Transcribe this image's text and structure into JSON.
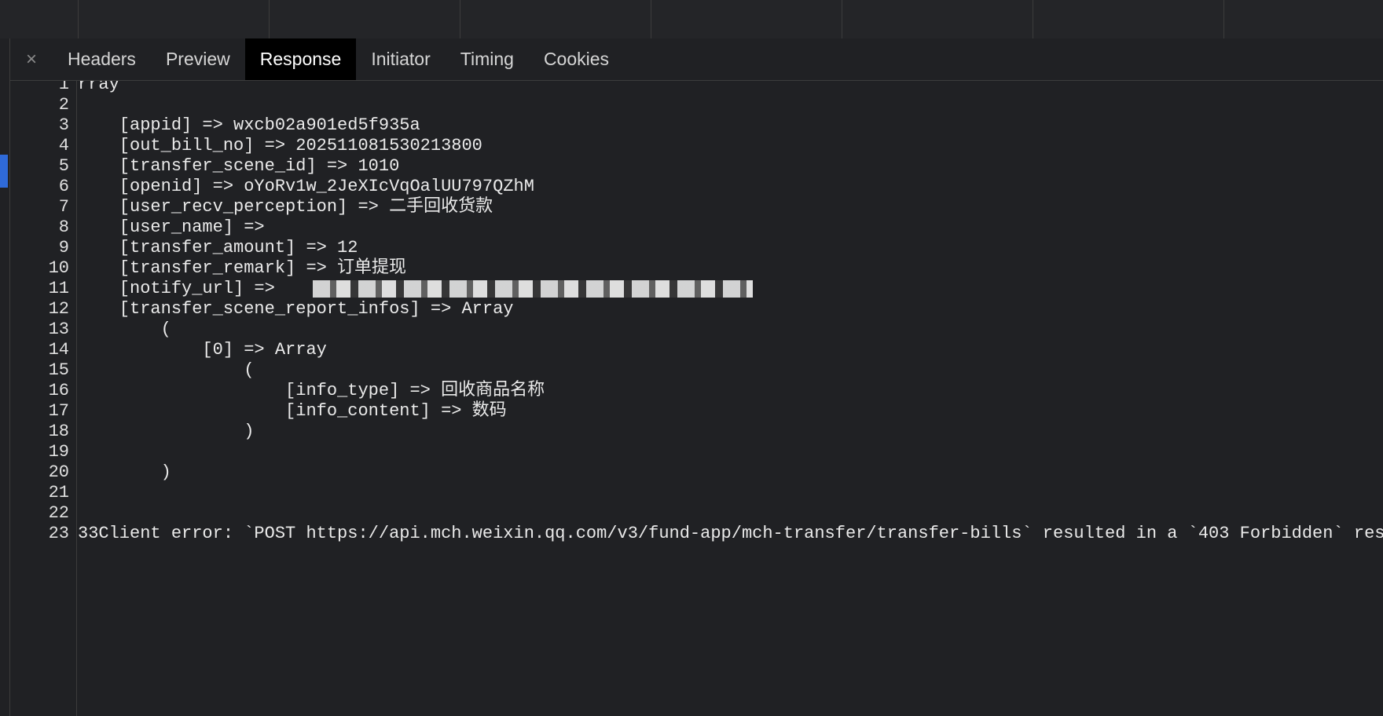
{
  "tabs": {
    "close_symbol": "×",
    "items": [
      "Headers",
      "Preview",
      "Response",
      "Initiator",
      "Timing",
      "Cookies"
    ],
    "active": "Response"
  },
  "response": {
    "lines": [
      {
        "n": "1",
        "text": "rray"
      },
      {
        "n": "2",
        "text": ""
      },
      {
        "n": "3",
        "text": "    [appid] => wxcb02a901ed5f935a"
      },
      {
        "n": "4",
        "text": "    [out_bill_no] => 202511081530213800"
      },
      {
        "n": "5",
        "text": "    [transfer_scene_id] => 1010"
      },
      {
        "n": "6",
        "text": "    [openid] => oYoRv1w_2JeXIcVqOalUU797QZhM"
      },
      {
        "n": "7",
        "text": "    [user_recv_perception] => 二手回收货款"
      },
      {
        "n": "8",
        "text": "    [user_name] =>"
      },
      {
        "n": "9",
        "text": "    [transfer_amount] => 12"
      },
      {
        "n": "10",
        "text": "    [transfer_remark] => 订单提现"
      },
      {
        "n": "11",
        "text": "    [notify_url] => "
      },
      {
        "n": "12",
        "text": "    [transfer_scene_report_infos] => Array"
      },
      {
        "n": "13",
        "text": "        ("
      },
      {
        "n": "14",
        "text": "            [0] => Array"
      },
      {
        "n": "15",
        "text": "                ("
      },
      {
        "n": "16",
        "text": "                    [info_type] => 回收商品名称"
      },
      {
        "n": "17",
        "text": "                    [info_content] => 数码"
      },
      {
        "n": "18",
        "text": "                )"
      },
      {
        "n": "19",
        "text": ""
      },
      {
        "n": "20",
        "text": "        )"
      },
      {
        "n": "21",
        "text": ""
      },
      {
        "n": "22",
        "text": ""
      },
      {
        "n": "23",
        "text": "33Client error: `POST https://api.mch.weixin.qq.com/v3/fund-app/mch-transfer/transfer-bills` resulted in a `403 Forbidden` res"
      }
    ]
  }
}
